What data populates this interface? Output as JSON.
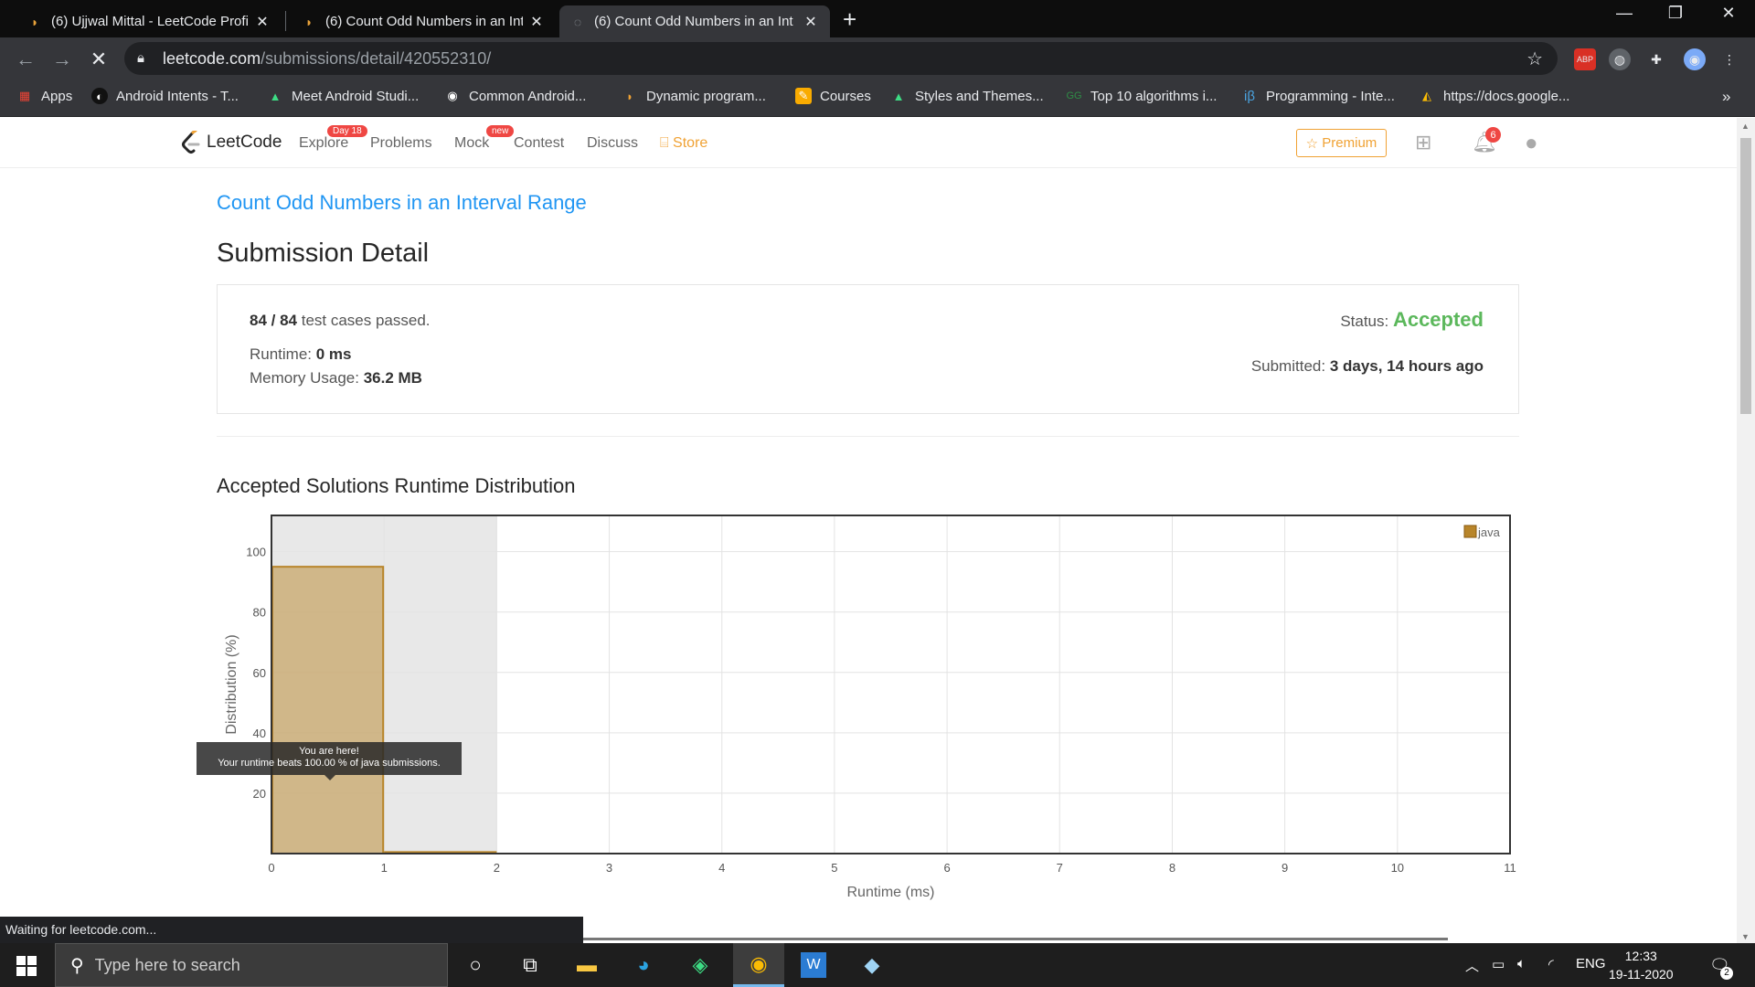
{
  "browser": {
    "tabs": [
      {
        "title": "(6) Ujjwal Mittal - LeetCode Profi",
        "active": false
      },
      {
        "title": "(6) Count Odd Numbers in an Int",
        "active": false
      },
      {
        "title": "(6) Count Odd Numbers in an Int",
        "active": true
      }
    ],
    "close_glyph": "✕",
    "new_tab_glyph": "+",
    "url_host": "leetcode.com",
    "url_path": "/submissions/detail/420552310/",
    "bookmarks": [
      {
        "label": "Apps",
        "icon": "apps-grid-icon"
      },
      {
        "label": "Android Intents - T...",
        "icon": "site-icon"
      },
      {
        "label": "Meet Android Studi...",
        "icon": "android-icon"
      },
      {
        "label": "Common Android...",
        "icon": "chrome-icon"
      },
      {
        "label": "Dynamic program...",
        "icon": "leetcode-icon"
      },
      {
        "label": "Courses",
        "icon": "pencil-icon"
      },
      {
        "label": "Styles and Themes...",
        "icon": "android-icon"
      },
      {
        "label": "Top 10 algorithms i...",
        "icon": "gfg-icon"
      },
      {
        "label": "Programming - Inte...",
        "icon": "interviewbit-icon"
      },
      {
        "label": "https://docs.google...",
        "icon": "drive-icon"
      }
    ],
    "bookmarks_overflow": "»",
    "status_text": "Waiting for leetcode.com..."
  },
  "leetcode_nav": {
    "logo_text": "LeetCode",
    "links": [
      {
        "label": "Explore",
        "badge": "Day 18"
      },
      {
        "label": "Problems",
        "badge": ""
      },
      {
        "label": "Mock",
        "badge": "new"
      },
      {
        "label": "Contest",
        "badge": ""
      },
      {
        "label": "Discuss",
        "badge": ""
      },
      {
        "label": "Store",
        "badge": ""
      }
    ],
    "premium_label": "Premium",
    "notification_count": "6"
  },
  "submission": {
    "problem_title": "Count Odd Numbers in an Interval Range",
    "heading": "Submission Detail",
    "passed": "84 / 84",
    "passed_suffix": " test cases passed.",
    "runtime_label": "Runtime: ",
    "runtime_value": "0 ms",
    "memory_label": "Memory Usage: ",
    "memory_value": "36.2 MB",
    "status_label": "Status: ",
    "status_value": "Accepted",
    "submitted_label": "Submitted: ",
    "submitted_value": "3 days, 14 hours ago"
  },
  "distribution": {
    "title": "Accepted Solutions Runtime Distribution",
    "tooltip_line1": "You are here!",
    "tooltip_line2": "Your runtime beats 100.00 % of java submissions."
  },
  "chart_data": {
    "type": "bar",
    "title": "",
    "xlabel": "Runtime (ms)",
    "ylabel": "Distribution (%)",
    "x_ticks": [
      "0",
      "1",
      "2",
      "3",
      "4",
      "5",
      "6",
      "7",
      "8",
      "9",
      "10",
      "11"
    ],
    "y_ticks": [
      "20",
      "40",
      "60",
      "80",
      "100"
    ],
    "xlim": [
      0,
      11
    ],
    "ylim": [
      0,
      112
    ],
    "series": [
      {
        "name": "java",
        "color": "#b8852a",
        "bins": [
          {
            "x0": 0,
            "x1": 1,
            "value": 95
          },
          {
            "x0": 1,
            "x1": 2,
            "value": 0.5
          }
        ]
      }
    ],
    "highlight_range": [
      0,
      2
    ],
    "legend_position": "top-right",
    "grid": true
  },
  "taskbar": {
    "search_placeholder": "Type here to search",
    "language": "ENG",
    "time": "12:33",
    "date": "19-11-2020",
    "notification_count": "2"
  }
}
